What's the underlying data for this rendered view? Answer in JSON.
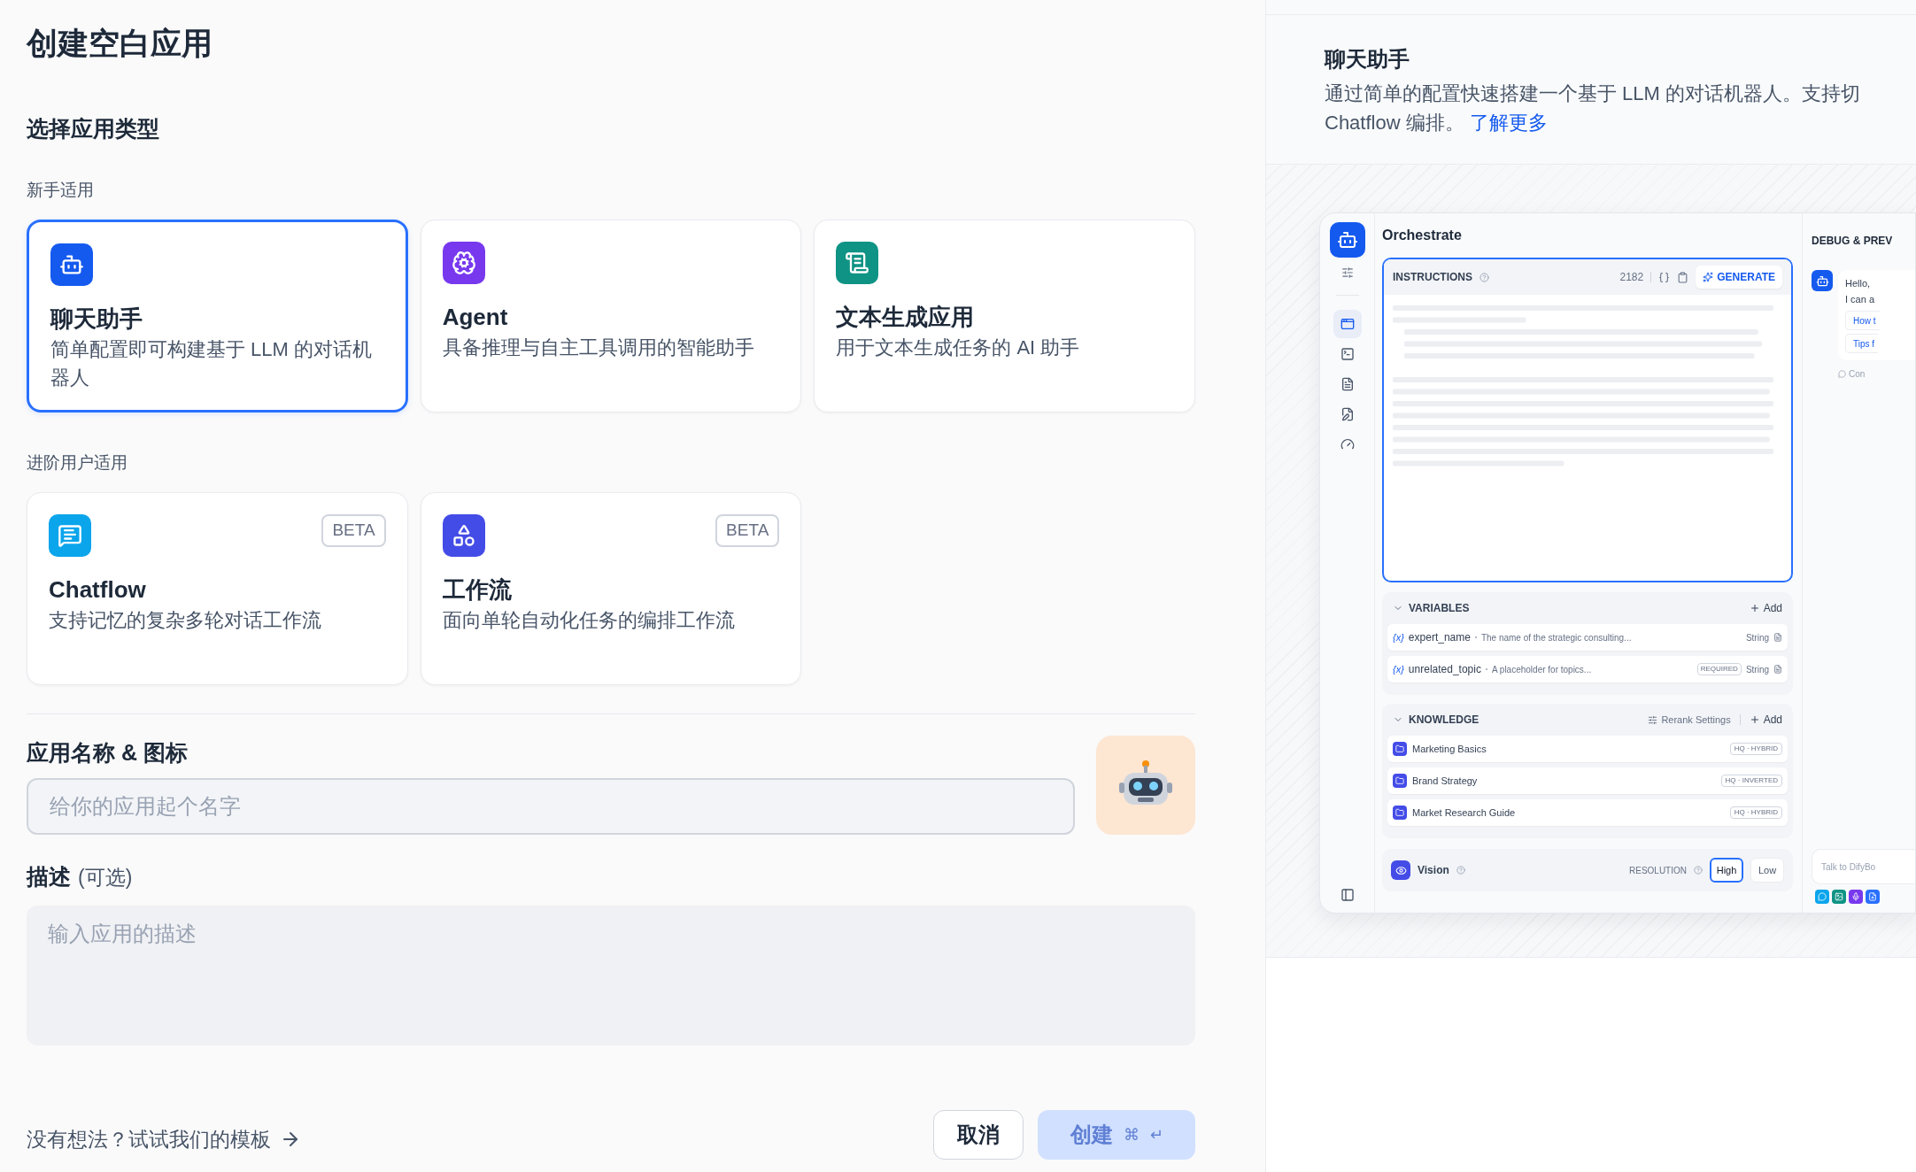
{
  "page_title": "创建空白应用",
  "type_heading": "选择应用类型",
  "groups": [
    {
      "label": "新手适用",
      "cards": [
        {
          "kind": "chatbot",
          "title": "聊天助手",
          "description": "简单配置即可构建基于 LLM 的对话机器人",
          "selected": true,
          "color": "#155aef"
        },
        {
          "kind": "agent",
          "title": "Agent",
          "description": "具备推理与自主工具调用的智能助手",
          "selected": false,
          "color": "#7839ee"
        },
        {
          "kind": "completion",
          "title": "文本生成应用",
          "description": "用于文本生成任务的 AI 助手",
          "selected": false,
          "color": "#0e9384"
        }
      ]
    },
    {
      "label": "进阶用户适用",
      "cards": [
        {
          "kind": "chatflow",
          "title": "Chatflow",
          "description": "支持记忆的复杂多轮对话工作流",
          "selected": false,
          "color": "#0ba5ec",
          "badge": "BETA"
        },
        {
          "kind": "workflow",
          "title": "工作流",
          "description": "面向单轮自动化任务的编排工作流",
          "selected": false,
          "color": "#444ce7",
          "badge": "BETA"
        }
      ]
    }
  ],
  "name_field": {
    "label": "应用名称 & 图标",
    "placeholder": "给你的应用起个名字"
  },
  "description_field": {
    "label": "描述",
    "optional": "(可选)",
    "placeholder": "输入应用的描述"
  },
  "template_link": "没有想法？试试我们的模板",
  "buttons": [
    {
      "kind": "cancel",
      "label": "取消",
      "disabled": false
    },
    {
      "kind": "create",
      "label": "创建",
      "disabled": true,
      "shortcut": [
        "⌘",
        "↵"
      ]
    }
  ],
  "preview": {
    "title": "聊天助手",
    "description": "通过简单的配置快速搭建一个基于 LLM 的对话机器人。支持切\nChatflow 编排。",
    "link": "了解更多",
    "nav": [
      {
        "kind": "prompt",
        "selected": true
      },
      {
        "kind": "terminal",
        "selected": false
      },
      {
        "kind": "logs",
        "selected": false
      },
      {
        "kind": "annotate",
        "selected": false
      },
      {
        "kind": "monitor",
        "selected": false
      }
    ],
    "heading": "Orchestrate",
    "instructions": {
      "label": "INSTRUCTIONS",
      "count": "2182",
      "button": "GENERATE"
    },
    "variables": {
      "label": "VARIABLES",
      "add": "Add",
      "items": [
        {
          "symbol": "{x}",
          "name": "expert_name",
          "description": "The name of the strategic consulting...",
          "type": "String"
        },
        {
          "symbol": "{x}",
          "name": "unrelated_topic",
          "description": "A placeholder for topics...",
          "badge": "REQUIRED",
          "type": "String"
        }
      ]
    },
    "knowledge": {
      "label": "KNOWLEDGE",
      "settings": "Rerank Settings",
      "add": "Add",
      "items": [
        {
          "name": "Marketing Basics",
          "tag": "HQ · HYBRID"
        },
        {
          "name": "Brand Strategy",
          "tag": "HQ · INVERTED"
        },
        {
          "name": "Market Research Guide",
          "tag": "HQ · HYBRID"
        }
      ]
    },
    "vision": {
      "label": "Vision",
      "resolution_label": "RESOLUTION",
      "options": [
        {
          "label": "High",
          "selected": true
        },
        {
          "label": "Low",
          "selected": false
        }
      ]
    },
    "debug": {
      "title": "DEBUG & PREV",
      "message": [
        "Hello,",
        "I can a"
      ],
      "suggestions": [
        "How t",
        "Tips f"
      ],
      "note": "Con",
      "input_placeholder": "Talk to DifyBo"
    }
  }
}
